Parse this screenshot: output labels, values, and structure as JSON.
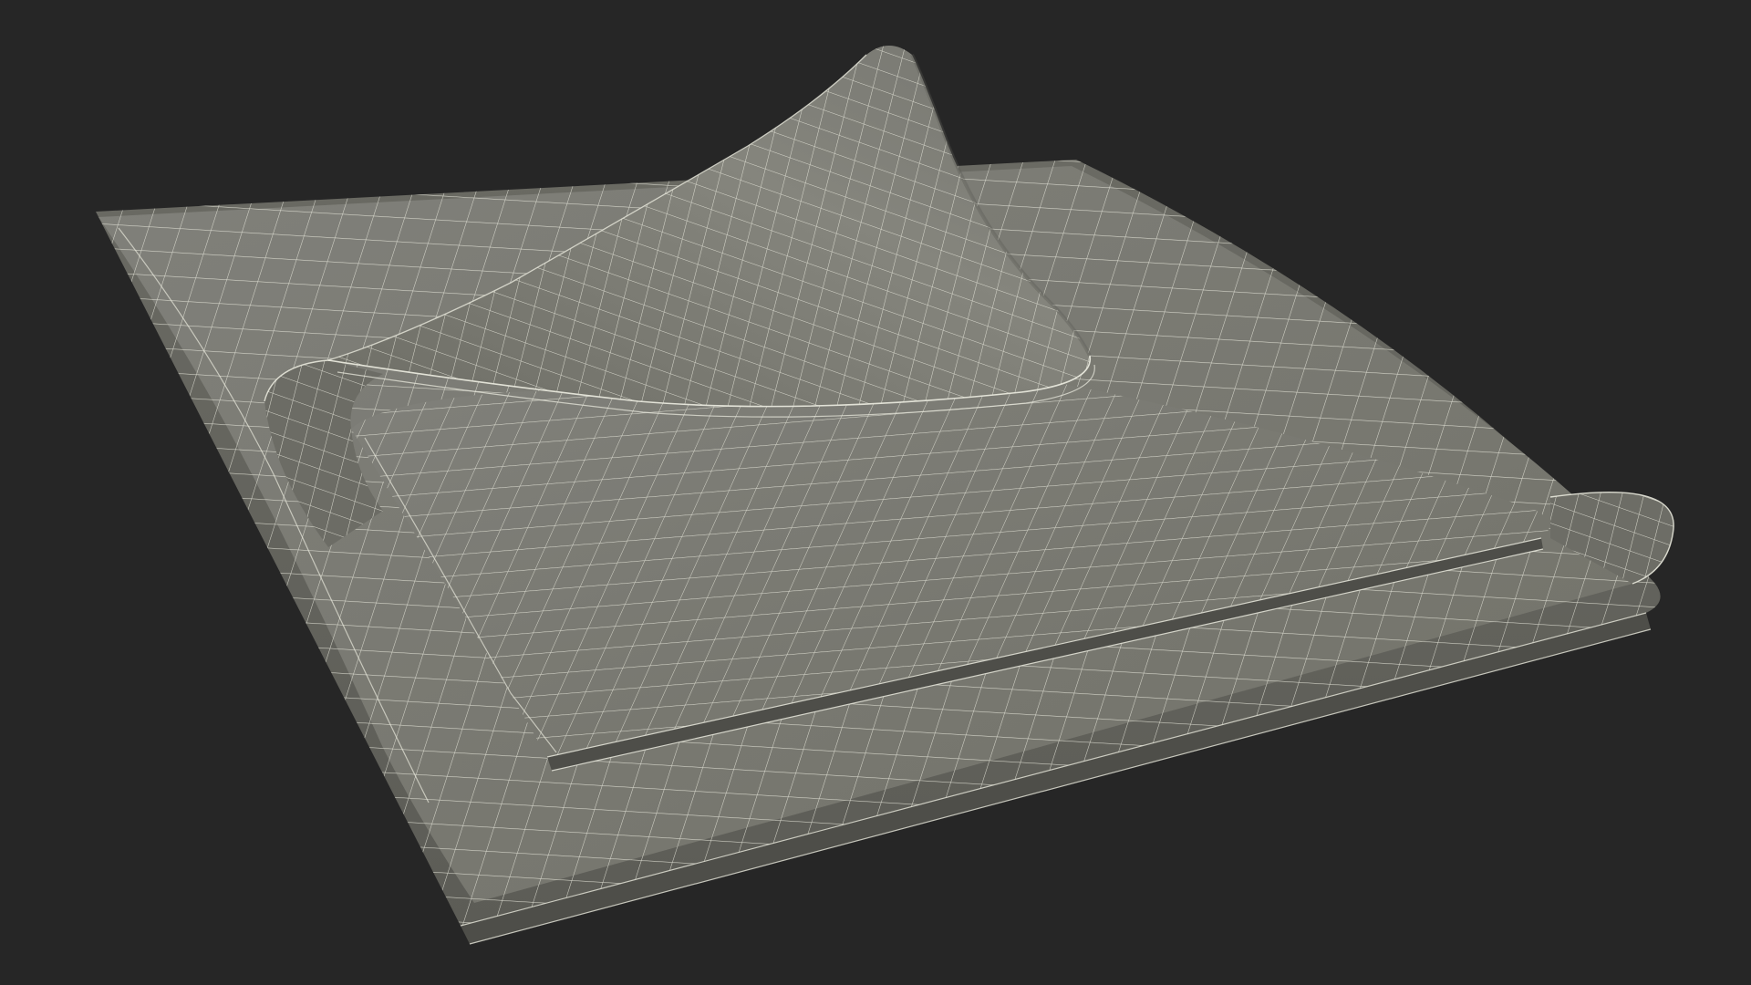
{
  "scene": {
    "subject": "folded-cloth-wireframe-render",
    "colors": {
      "background": "#262626",
      "cloth_fill": "#7a7a72",
      "cloth_fill_dark": "#6b6b64",
      "cloth_fill_light": "#8a8a82",
      "wire": "#e8e8dc",
      "edge_shadow": "#4e4e49"
    }
  }
}
